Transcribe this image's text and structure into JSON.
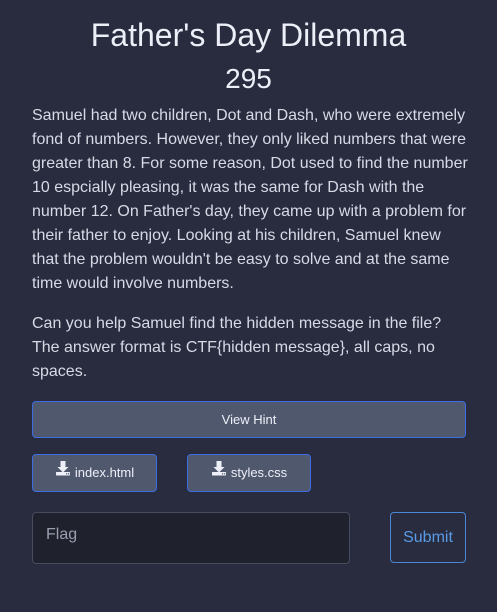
{
  "challenge": {
    "title": "Father's Day Dilemma",
    "points": "295",
    "description": [
      "Samuel had two children, Dot and Dash, who were extremely fond of numbers. However, they only liked numbers that were greater than 8. For some reason, Dot used to find the number 10 espcially pleasing, it was the same for Dash with the number 12. On Father's day, they came up with a problem for their father to enjoy. Looking at his children, Samuel knew that the problem wouldn't be easy to solve and at the same time would involve numbers.",
      "Can you help Samuel find the hidden message in the file? The answer format is CTF{hidden message}, all caps, no spaces."
    ]
  },
  "hint_button": {
    "label": "View Hint"
  },
  "files": [
    {
      "name": "index.html",
      "icon": "download-icon"
    },
    {
      "name": "styles.css",
      "icon": "download-icon"
    }
  ],
  "flag_form": {
    "placeholder": "Flag",
    "value": "",
    "submit_label": "Submit"
  },
  "colors": {
    "background": "#292c3e",
    "button_fill": "#50586e",
    "button_border": "#3d6de0",
    "submit_accent": "#5a9be8",
    "input_fill": "#1f212d"
  }
}
